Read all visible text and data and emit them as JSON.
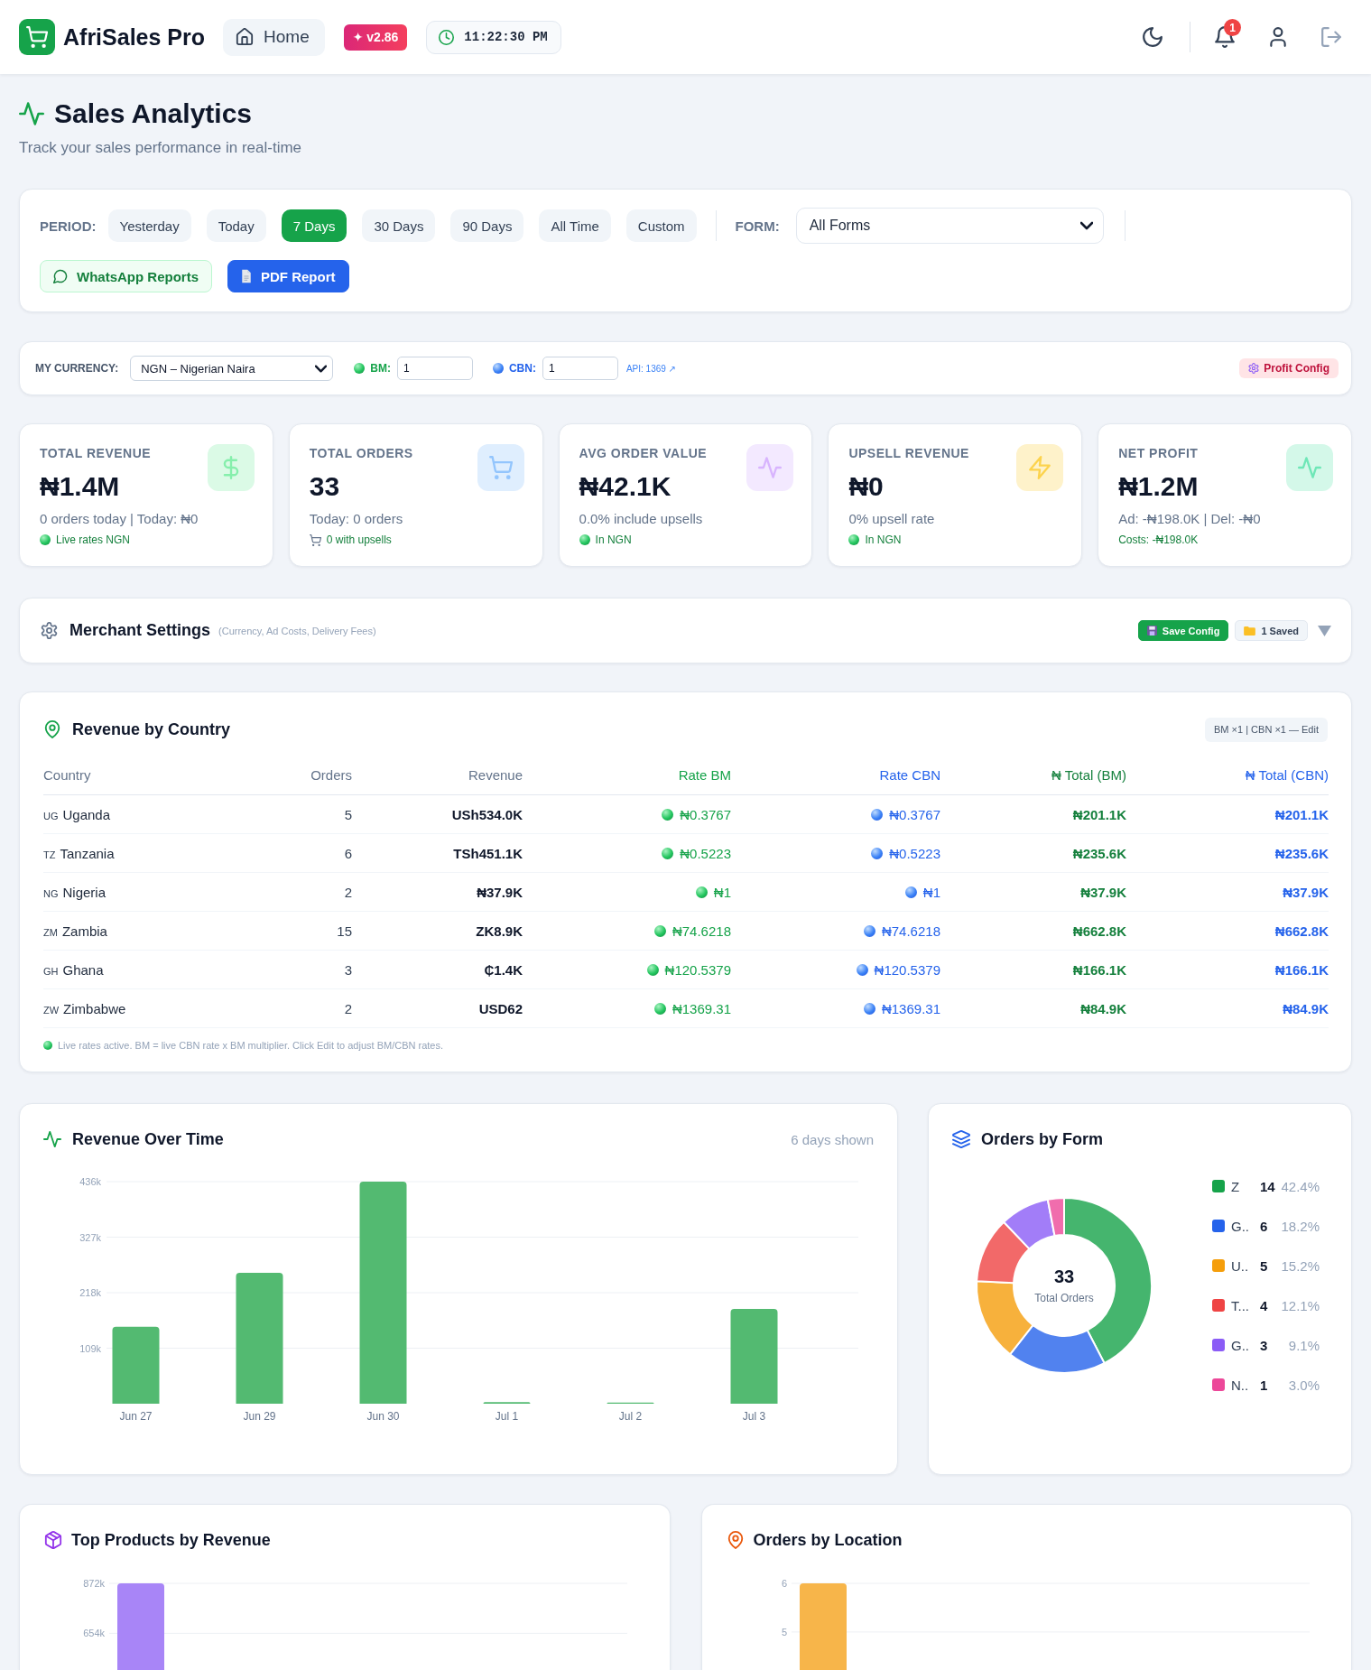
{
  "header": {
    "app_name": "AfriSales Pro",
    "home_button": "Home",
    "version": "✦ v2.86",
    "clock": "11:22:30 PM",
    "notification_count": "1"
  },
  "page": {
    "title": "Sales Analytics",
    "subtitle": "Track your sales performance in real-time"
  },
  "filters": {
    "period_label": "PERIOD:",
    "periods": [
      {
        "label": "Yesterday",
        "selected": false
      },
      {
        "label": "Today",
        "selected": false
      },
      {
        "label": "7 Days",
        "selected": true
      },
      {
        "label": "30 Days",
        "selected": false
      },
      {
        "label": "90 Days",
        "selected": false
      },
      {
        "label": "All Time",
        "selected": false
      },
      {
        "label": "Custom",
        "selected": false
      }
    ],
    "form_label": "FORM:",
    "form_value": "All Forms",
    "actions": [
      {
        "kind": "whatsapp",
        "label": "WhatsApp Reports"
      },
      {
        "kind": "pdf",
        "label": "PDF Report"
      }
    ]
  },
  "currency": {
    "label": "MY CURRENCY:",
    "value": "NGN – Nigerian Naira",
    "rates": [
      {
        "kind": "bm",
        "label": "BM:",
        "value": "1"
      },
      {
        "kind": "cbn",
        "label": "CBN:",
        "value": "1"
      }
    ],
    "api_link": "API: 1369 ↗",
    "profit_button": "Profit Config"
  },
  "stats": [
    {
      "label": "TOTAL REVENUE",
      "value": "₦1.4M",
      "detail": "0 orders today | Today: ₦0",
      "note": "Live rates NGN",
      "color": "#86efac"
    },
    {
      "label": "TOTAL ORDERS",
      "value": "33",
      "detail": "Today: 0 orders",
      "note": "0 with upsells",
      "color": "#93c5fd"
    },
    {
      "label": "AVG ORDER VALUE",
      "value": "₦42.1K",
      "detail": "0.0% include upsells",
      "note": "In NGN",
      "color": "#d8b4fe"
    },
    {
      "label": "UPSELL REVENUE",
      "value": "₦0",
      "detail": "0% upsell rate",
      "note": "In NGN",
      "color": "#fcd34d"
    },
    {
      "label": "NET PROFIT",
      "value": "₦1.2M",
      "detail": "Ad: -₦198.0K | Del: -₦0",
      "note": "Costs: -₦198.0K",
      "color": "#6ee7b7"
    }
  ],
  "merchant_settings": {
    "title": "Merchant Settings",
    "hint": "(Currency, Ad Costs, Delivery Fees)",
    "save_button": "Save Config",
    "saved_button": "1 Saved",
    "expanded": false
  },
  "revenue_by_country": {
    "title": "Revenue by Country",
    "edit_button": "BM ×1 | CBN ×1 — Edit",
    "columns": [
      "Country",
      "Orders",
      "Revenue",
      "Rate BM",
      "Rate CBN",
      "₦ Total (BM)",
      "₦ Total (CBN)"
    ],
    "rows": [
      {
        "code": "UG",
        "country": "Uganda",
        "orders": "5",
        "revenue": "USh534.0K",
        "rate_bm": "₦0.3767",
        "rate_cbn": "₦0.3767",
        "total_bm": "₦201.1K",
        "total_cbn": "₦201.1K"
      },
      {
        "code": "TZ",
        "country": "Tanzania",
        "orders": "6",
        "revenue": "TSh451.1K",
        "rate_bm": "₦0.5223",
        "rate_cbn": "₦0.5223",
        "total_bm": "₦235.6K",
        "total_cbn": "₦235.6K"
      },
      {
        "code": "NG",
        "country": "Nigeria",
        "orders": "2",
        "revenue": "₦37.9K",
        "rate_bm": "₦1",
        "rate_cbn": "₦1",
        "total_bm": "₦37.9K",
        "total_cbn": "₦37.9K"
      },
      {
        "code": "ZM",
        "country": "Zambia",
        "orders": "15",
        "revenue": "ZK8.9K",
        "rate_bm": "₦74.6218",
        "rate_cbn": "₦74.6218",
        "total_bm": "₦662.8K",
        "total_cbn": "₦662.8K"
      },
      {
        "code": "GH",
        "country": "Ghana",
        "orders": "3",
        "revenue": "₵1.4K",
        "rate_bm": "₦120.5379",
        "rate_cbn": "₦120.5379",
        "total_bm": "₦166.1K",
        "total_cbn": "₦166.1K"
      },
      {
        "code": "ZW",
        "country": "Zimbabwe",
        "orders": "2",
        "revenue": "USD62",
        "rate_bm": "₦1369.31",
        "rate_cbn": "₦1369.31",
        "total_bm": "₦84.9K",
        "total_cbn": "₦84.9K"
      }
    ],
    "note": "Live rates active. BM = live CBN rate x BM multiplier. Click Edit to adjust BM/CBN rates."
  },
  "revenue_over_time": {
    "title": "Revenue Over Time",
    "caption": "6 days shown",
    "chart_data": {
      "type": "bar",
      "categories": [
        "Jun 27",
        "Jun 29",
        "Jun 30",
        "Jul 1",
        "Jul 2",
        "Jul 3"
      ],
      "values": [
        151000,
        257000,
        436000,
        3000,
        2000,
        186000
      ],
      "ylim": [
        0,
        436000
      ],
      "yticks": [
        {
          "value": 109000,
          "label": "109k"
        },
        {
          "value": 218000,
          "label": "218k"
        },
        {
          "value": 327000,
          "label": "327k"
        },
        {
          "value": 436000,
          "label": "436k"
        }
      ],
      "grid": true
    }
  },
  "orders_by_form": {
    "title": "Orders by Form",
    "total": "33",
    "total_label": "Total Orders",
    "chart_data": {
      "type": "donut",
      "values": [
        42.4,
        18.2,
        15.2,
        12.1,
        9.1,
        3.0
      ]
    },
    "legend": [
      {
        "name": "Z",
        "count": "14",
        "percent": "42.4%",
        "color": "#16a34a"
      },
      {
        "name": "G..",
        "count": "6",
        "percent": "18.2%",
        "color": "#2563eb"
      },
      {
        "name": "U..",
        "count": "5",
        "percent": "15.2%",
        "color": "#f59e0b"
      },
      {
        "name": "T...",
        "count": "4",
        "percent": "12.1%",
        "color": "#ef4444"
      },
      {
        "name": "G..",
        "count": "3",
        "percent": "9.1%",
        "color": "#8b5cf6"
      },
      {
        "name": "N..",
        "count": "1",
        "percent": "3.0%",
        "color": "#ec4899"
      }
    ]
  },
  "bottom_charts": [
    {
      "title": "Top Products by Revenue",
      "color": "#a885f7",
      "chart_data": {
        "type": "bar",
        "values": [
          872000
        ],
        "ylim": [
          490000,
          872000
        ],
        "yticks": [
          {
            "value": 654000,
            "label": "654k"
          },
          {
            "value": 872000,
            "label": "872k"
          }
        ],
        "grid": true
      }
    },
    {
      "title": "Orders by Location",
      "color": "#f7b54a",
      "chart_data": {
        "type": "bar",
        "values": [
          6
        ],
        "ylim": [
          4.2,
          6
        ],
        "yticks": [
          5,
          6
        ],
        "grid": true
      }
    }
  ]
}
